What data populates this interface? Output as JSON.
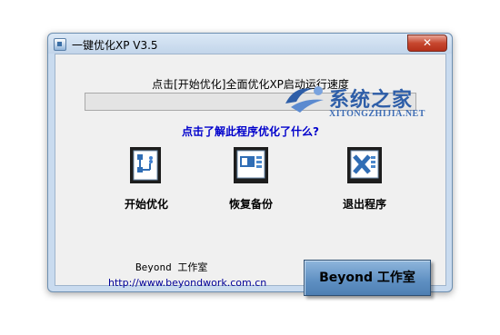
{
  "window": {
    "title": "一键优化XP V3.5",
    "close_label": "✕"
  },
  "main": {
    "header": "点击[开始优化]全面优化XP启动运行速度",
    "link": "点击了解此程序优化了什么?",
    "actions": [
      {
        "label": "开始优化",
        "icon": "flowchart-icon"
      },
      {
        "label": "恢复备份",
        "icon": "slideshow-icon"
      },
      {
        "label": "退出程序",
        "icon": "excel-x-icon"
      }
    ]
  },
  "footer": {
    "brand": "Beyond 工作室",
    "url": "http://www.beyondwork.com.cn",
    "brand_button": "Beyond 工作室"
  },
  "watermark": {
    "title": "系统之家",
    "subtitle": "XITONGZHIJIA.NET"
  }
}
